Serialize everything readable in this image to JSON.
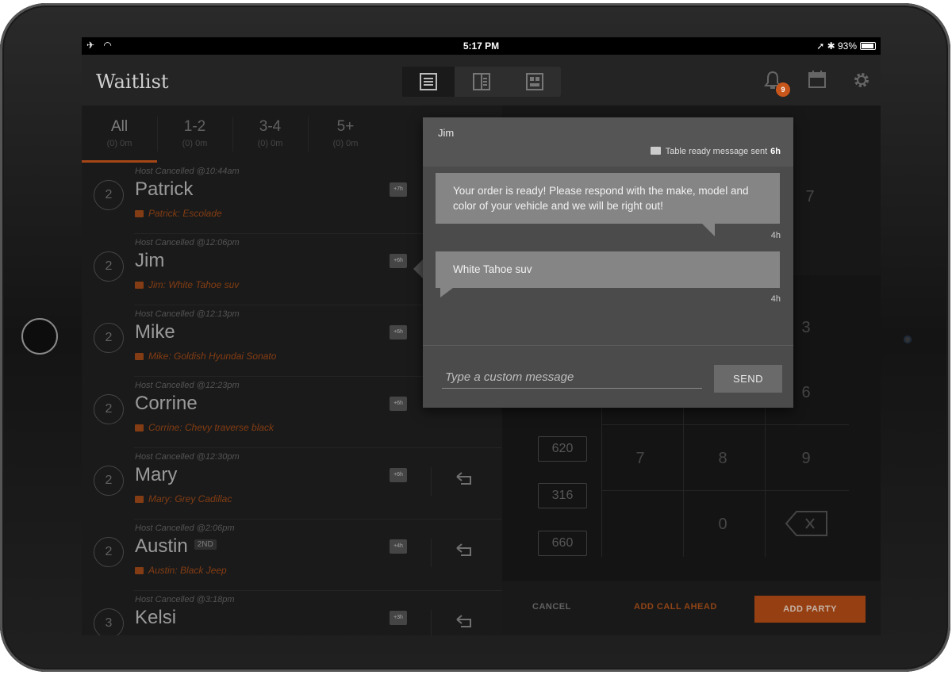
{
  "status_bar": {
    "time": "5:17 PM",
    "battery": "93%"
  },
  "header": {
    "title": "Waitlist",
    "notification_count": "9"
  },
  "tabs": [
    {
      "label": "All",
      "sub": "(0) 0m"
    },
    {
      "label": "1-2",
      "sub": "(0) 0m"
    },
    {
      "label": "3-4",
      "sub": "(0) 0m"
    },
    {
      "label": "5+",
      "sub": "(0) 0m"
    }
  ],
  "parties": [
    {
      "size": "2",
      "status": "Host Cancelled @10:44am",
      "name": "Patrick",
      "tag": "",
      "note": "Patrick: Escolade",
      "msg_time": "+7h"
    },
    {
      "size": "2",
      "status": "Host Cancelled @12:06pm",
      "name": "Jim",
      "tag": "",
      "note": "Jim: White Tahoe suv",
      "msg_time": "+6h"
    },
    {
      "size": "2",
      "status": "Host Cancelled @12:13pm",
      "name": "Mike",
      "tag": "",
      "note": "Mike: Goldish Hyundai Sonato",
      "msg_time": "+6h"
    },
    {
      "size": "2",
      "status": "Host Cancelled @12:23pm",
      "name": "Corrine",
      "tag": "",
      "note": "Corrine: Chevy traverse black",
      "msg_time": "+6h"
    },
    {
      "size": "2",
      "status": "Host Cancelled @12:30pm",
      "name": "Mary",
      "tag": "",
      "note": "Mary: Grey Cadillac",
      "msg_time": "+6h"
    },
    {
      "size": "2",
      "status": "Host Cancelled @2:06pm",
      "name": "Austin",
      "tag": "2ND",
      "note": "Austin: Black Jeep",
      "msg_time": "+4h"
    },
    {
      "size": "3",
      "status": "Host Cancelled @3:18pm",
      "name": "Kelsi",
      "tag": "",
      "note": "",
      "msg_time": "+3h"
    }
  ],
  "numpad": {
    "keys": [
      "7",
      "3",
      "6",
      "7",
      "8",
      "9",
      "0"
    ],
    "tables": [
      "620",
      "316",
      "660"
    ]
  },
  "footer": {
    "cancel": "CANCEL",
    "call_ahead": "ADD CALL AHEAD",
    "add_party": "ADD PARTY"
  },
  "popup": {
    "name": "Jim",
    "sent_label": "Table ready message sent",
    "sent_time": "6h",
    "messages": [
      {
        "text": "Your order is ready! Please respond with the make, model and color of your vehicle and we will be right out!",
        "time": "4h"
      },
      {
        "text": "White Tahoe suv",
        "time": "4h"
      }
    ],
    "input_placeholder": "Type a custom message",
    "send_label": "SEND"
  },
  "colors": {
    "accent": "#c8561b",
    "note": "#a04a18"
  }
}
